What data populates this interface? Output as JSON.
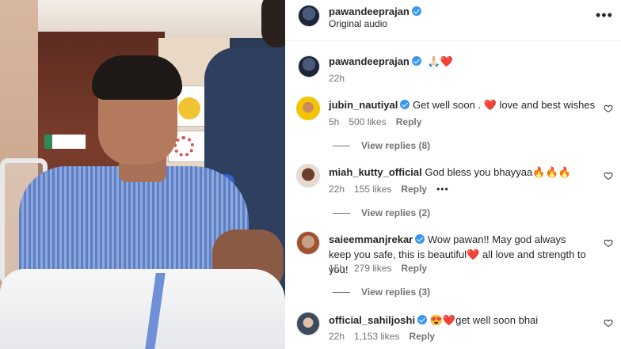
{
  "header": {
    "username": "pawandeeprajan",
    "subtitle": "Original audio",
    "more_label": "•••"
  },
  "caption": {
    "username": "pawandeeprajan",
    "emojis": "🙏🏻❤️",
    "time": "22h"
  },
  "comments": [
    {
      "username": "jubin_nautiyal",
      "verified": true,
      "text_a": "Get well soon . ",
      "emoji_a": "❤️",
      "text_b": " love and best wishes",
      "time": "5h",
      "likes": "500 likes",
      "reply": "Reply",
      "view_replies": "View replies (8)"
    },
    {
      "username": "miah_kutty_official",
      "verified": false,
      "text_a": "God bless you bhayyaa",
      "emoji_a": "🔥🔥🔥",
      "time": "22h",
      "likes": "155 likes",
      "reply": "Reply",
      "more": "•••",
      "view_replies": "View replies (2)"
    },
    {
      "username": "saieemmanjrekar",
      "verified": true,
      "text_a": "Wow pawan!! May god always keep you safe, this is beautiful",
      "emoji_a": "❤️",
      "text_b": " all love and strength to you!",
      "time": "15h",
      "likes": "279 likes",
      "reply": "Reply",
      "view_replies": "View replies (3)"
    },
    {
      "username": "official_sahiljoshi",
      "verified": true,
      "emoji_a": "😍❤️",
      "text_a": "get well soon bhai",
      "time": "22h",
      "likes": "1,153 likes",
      "reply": "Reply"
    }
  ],
  "icons": {
    "like": "heart-outline-icon",
    "verified": "verified-badge-icon",
    "more": "more-horizontal-icon"
  },
  "colors": {
    "verified": "#3897f0",
    "meta_text": "#737373",
    "heart": "#e0245e"
  }
}
